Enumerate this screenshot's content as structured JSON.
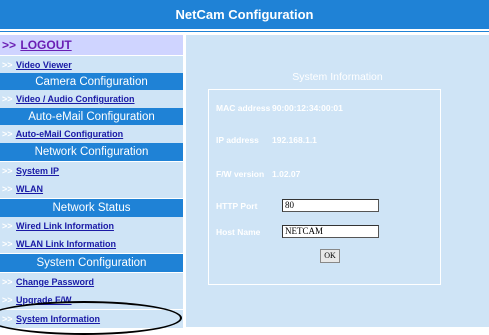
{
  "header": {
    "title": "NetCam Configuration"
  },
  "sidebar": {
    "arrow": ">>",
    "logout": "LOGOUT",
    "video_viewer": "Video Viewer",
    "sections": {
      "camera": "Camera Configuration",
      "email": "Auto-eMail Configuration",
      "network": "Network Configuration",
      "status": "Network Status",
      "system": "System Configuration"
    },
    "links": {
      "video_audio": "Video / Audio Configuration",
      "auto_email": "Auto-eMail Configuration",
      "system_ip": "System IP",
      "wlan": "WLAN",
      "wired_link": "Wired Link Information",
      "wlan_link": "WLAN Link Information",
      "change_password": "Change Password",
      "upgrade_fw": "Upgrade F/W",
      "system_info": "System Information"
    }
  },
  "main": {
    "title": "System Information",
    "rows": {
      "mac": {
        "label": "MAC address",
        "value": "90:00:12:34:00:01"
      },
      "ip": {
        "label": "IP address",
        "value": "192.168.1.1"
      },
      "fw": {
        "label": "F/W version",
        "value": "1.02.07"
      },
      "http": {
        "label": "HTTP Port",
        "value": "80"
      },
      "host": {
        "label": "Host Name",
        "value": "NETCAM"
      }
    },
    "ok_label": "OK"
  },
  "colors": {
    "header_blue": "#1f82d6",
    "panel_light_blue": "#cfe4f6",
    "link_text": "#1a1aa6",
    "logout_text": "#6a1fb4"
  }
}
